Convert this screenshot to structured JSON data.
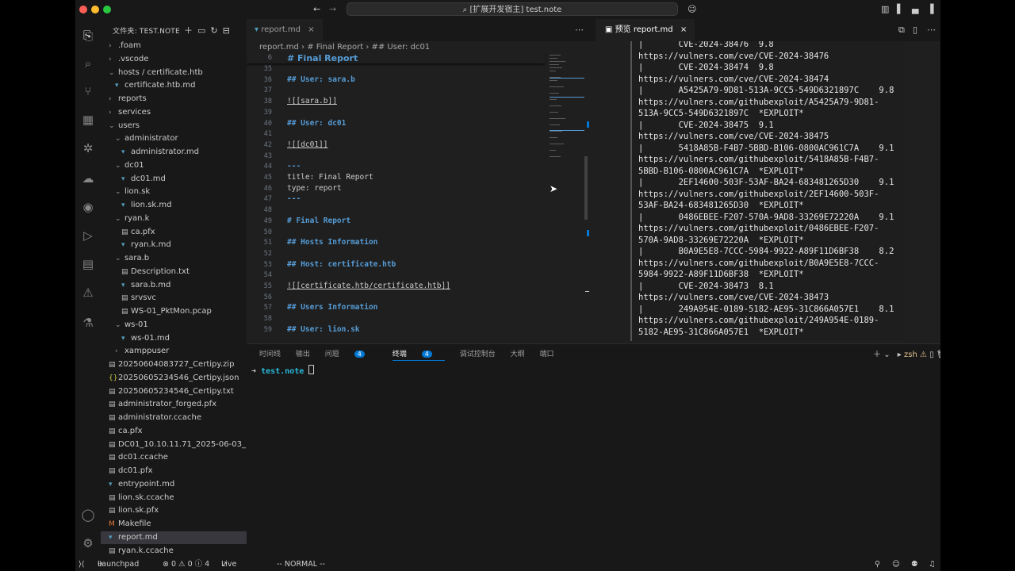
{
  "titlebar": {
    "title": "[扩展开发宿主] test.note"
  },
  "activity": [
    {
      "name": "files-icon",
      "glyph": "⎘"
    },
    {
      "name": "search-icon",
      "glyph": "⌕"
    },
    {
      "name": "source-control-icon",
      "glyph": "⑂"
    },
    {
      "name": "extensions-icon",
      "glyph": "▦"
    },
    {
      "name": "kubernetes-icon",
      "glyph": "✲"
    },
    {
      "name": "remote-explorer-icon",
      "glyph": "☁"
    },
    {
      "name": "copilot-icon",
      "glyph": "◉"
    },
    {
      "name": "run-debug-icon",
      "glyph": "▷"
    },
    {
      "name": "notebook-icon",
      "glyph": "▤"
    },
    {
      "name": "warning-icon",
      "glyph": "⚠"
    },
    {
      "name": "testing-icon",
      "glyph": "⚗"
    }
  ],
  "activity_bottom": [
    {
      "name": "account-icon",
      "glyph": "◯"
    },
    {
      "name": "settings-gear-icon",
      "glyph": "⚙"
    }
  ],
  "sidebar": {
    "header": "文件夹: TEST.NOTE",
    "items": [
      {
        "label": ".foam",
        "depth": 0,
        "kind": "folder",
        "open": false
      },
      {
        "label": ".vscode",
        "depth": 0,
        "kind": "folder",
        "open": false
      },
      {
        "label": "hosts / certificate.htb",
        "depth": 0,
        "kind": "folder",
        "open": true
      },
      {
        "label": "certificate.htb.md",
        "depth": 1,
        "kind": "md"
      },
      {
        "label": "reports",
        "depth": 0,
        "kind": "folder",
        "open": false
      },
      {
        "label": "services",
        "depth": 0,
        "kind": "folder",
        "open": false
      },
      {
        "label": "users",
        "depth": 0,
        "kind": "folder",
        "open": true
      },
      {
        "label": "administrator",
        "depth": 1,
        "kind": "folder",
        "open": true
      },
      {
        "label": "administrator.md",
        "depth": 2,
        "kind": "md"
      },
      {
        "label": "dc01",
        "depth": 1,
        "kind": "folder",
        "open": true
      },
      {
        "label": "dc01.md",
        "depth": 2,
        "kind": "md"
      },
      {
        "label": "lion.sk",
        "depth": 1,
        "kind": "folder",
        "open": true
      },
      {
        "label": "lion.sk.md",
        "depth": 2,
        "kind": "md"
      },
      {
        "label": "ryan.k",
        "depth": 1,
        "kind": "folder",
        "open": true
      },
      {
        "label": "ca.pfx",
        "depth": 2,
        "kind": "file"
      },
      {
        "label": "ryan.k.md",
        "depth": 2,
        "kind": "md"
      },
      {
        "label": "sara.b",
        "depth": 1,
        "kind": "folder",
        "open": true
      },
      {
        "label": "Description.txt",
        "depth": 2,
        "kind": "file"
      },
      {
        "label": "sara.b.md",
        "depth": 2,
        "kind": "md"
      },
      {
        "label": "srvsvc",
        "depth": 2,
        "kind": "file"
      },
      {
        "label": "WS-01_PktMon.pcap",
        "depth": 2,
        "kind": "file"
      },
      {
        "label": "ws-01",
        "depth": 1,
        "kind": "folder",
        "open": true
      },
      {
        "label": "ws-01.md",
        "depth": 2,
        "kind": "md"
      },
      {
        "label": "xamppuser",
        "depth": 1,
        "kind": "folder",
        "open": false
      },
      {
        "label": "20250604083727_Certipy.zip",
        "depth": 0,
        "kind": "zip"
      },
      {
        "label": "20250605234546_Certipy.json",
        "depth": 0,
        "kind": "json"
      },
      {
        "label": "20250605234546_Certipy.txt",
        "depth": 0,
        "kind": "file"
      },
      {
        "label": "administrator_forged.pfx",
        "depth": 0,
        "kind": "file"
      },
      {
        "label": "administrator.ccache",
        "depth": 0,
        "kind": "file"
      },
      {
        "label": "ca.pfx",
        "depth": 0,
        "kind": "file"
      },
      {
        "label": "DC01_10.10.11.71_2025-06-03_...",
        "depth": 0,
        "kind": "file"
      },
      {
        "label": "dc01.ccache",
        "depth": 0,
        "kind": "file"
      },
      {
        "label": "dc01.pfx",
        "depth": 0,
        "kind": "file"
      },
      {
        "label": "entrypoint.md",
        "depth": 0,
        "kind": "md"
      },
      {
        "label": "lion.sk.ccache",
        "depth": 0,
        "kind": "file"
      },
      {
        "label": "lion.sk.pfx",
        "depth": 0,
        "kind": "file"
      },
      {
        "label": "Makefile",
        "depth": 0,
        "kind": "make"
      },
      {
        "label": "report.md",
        "depth": 0,
        "kind": "md",
        "selected": true
      },
      {
        "label": "ryan.k.ccache",
        "depth": 0,
        "kind": "file"
      }
    ]
  },
  "editor": {
    "tab": "report.md",
    "breadcrumb": [
      "report.md",
      "# Final Report",
      "## User: dc01"
    ],
    "sticky": {
      "num": "6",
      "text": "# Final Report"
    },
    "lines": [
      {
        "n": "35",
        "t": "",
        "cls": ""
      },
      {
        "n": "36",
        "t": "## User: sara.b",
        "cls": "hd"
      },
      {
        "n": "37",
        "t": "",
        "cls": ""
      },
      {
        "n": "38",
        "t": "![[sara.b]]",
        "cls": "lk"
      },
      {
        "n": "39",
        "t": "",
        "cls": ""
      },
      {
        "n": "40",
        "t": "## User: dc01",
        "cls": "hd"
      },
      {
        "n": "41",
        "t": "",
        "cls": ""
      },
      {
        "n": "42",
        "t": "![[dc01]]",
        "cls": "lk"
      },
      {
        "n": "43",
        "t": "",
        "cls": ""
      },
      {
        "n": "44",
        "t": "---",
        "cls": "hd"
      },
      {
        "n": "45",
        "t": "title: Final Report",
        "cls": ""
      },
      {
        "n": "46",
        "t": "type: report",
        "cls": ""
      },
      {
        "n": "47",
        "t": "---",
        "cls": "hd"
      },
      {
        "n": "48",
        "t": "",
        "cls": ""
      },
      {
        "n": "49",
        "t": "# Final Report",
        "cls": "hd"
      },
      {
        "n": "50",
        "t": "",
        "cls": ""
      },
      {
        "n": "51",
        "t": "## Hosts Information",
        "cls": "hd"
      },
      {
        "n": "52",
        "t": "",
        "cls": ""
      },
      {
        "n": "53",
        "t": "## Host: certificate.htb",
        "cls": "hd"
      },
      {
        "n": "54",
        "t": "",
        "cls": ""
      },
      {
        "n": "55",
        "t": "![[certificate.htb/certificate.htb]]",
        "cls": "lk"
      },
      {
        "n": "56",
        "t": "",
        "cls": ""
      },
      {
        "n": "57",
        "t": "## Users Information",
        "cls": "hd"
      },
      {
        "n": "58",
        "t": "",
        "cls": ""
      },
      {
        "n": "59",
        "t": "## User: lion.sk",
        "cls": "hd"
      }
    ]
  },
  "preview": {
    "tab": "预览 report.md",
    "lines": [
      "|       CVE-2024-38476  9.8",
      "https://vulners.com/cve/CVE-2024-38476",
      "|       CVE-2024-38474  9.8",
      "https://vulners.com/cve/CVE-2024-38474",
      "|       A5425A79-9D81-513A-9CC5-549D6321897C    9.8",
      "https://vulners.com/githubexploit/A5425A79-9D81-",
      "513A-9CC5-549D6321897C  *EXPLOIT*",
      "|       CVE-2024-38475  9.1",
      "https://vulners.com/cve/CVE-2024-38475",
      "|       5418A85B-F4B7-5BBD-B106-0800AC961C7A    9.1",
      "https://vulners.com/githubexploit/5418A85B-F4B7-",
      "5BBD-B106-0800AC961C7A  *EXPLOIT*",
      "|       2EF14600-503F-53AF-BA24-683481265D30    9.1",
      "https://vulners.com/githubexploit/2EF14600-503F-",
      "53AF-BA24-683481265D30  *EXPLOIT*",
      "|       0486EBEE-F207-570A-9AD8-33269E72220A    9.1",
      "https://vulners.com/githubexploit/0486EBEE-F207-",
      "570A-9AD8-33269E72220A  *EXPLOIT*",
      "|       B0A9E5E8-7CCC-5984-9922-A89F11D6BF38    8.2",
      "https://vulners.com/githubexploit/B0A9E5E8-7CCC-",
      "5984-9922-A89F11D6BF38  *EXPLOIT*",
      "|       CVE-2024-38473  8.1",
      "https://vulners.com/cve/CVE-2024-38473",
      "|       249A954E-0189-5182-AE95-31C866A057E1    8.1",
      "https://vulners.com/githubexploit/249A954E-0189-",
      "5182-AE95-31C866A057E1  *EXPLOIT*"
    ]
  },
  "panel": {
    "tabs": {
      "timeline": "时间线",
      "output": "输出",
      "problems": "问题",
      "problems_count": "4",
      "terminal": "终端",
      "terminal_count": "4",
      "debug": "调试控制台",
      "outline": "大纲",
      "ports": "端口"
    },
    "shell": "zsh",
    "prompt_arrow": "➜",
    "prompt_dir": "test.note"
  },
  "statusbar": {
    "launchpad": "Launchpad",
    "problems": "⊗ 0 ⚠ 0 ⓘ 4",
    "liveshare": "Live Share",
    "mode": "-- NORMAL --"
  },
  "colors": {
    "accent": "#0078d4",
    "heading": "#569cd6",
    "background": "#1f1f1f"
  }
}
